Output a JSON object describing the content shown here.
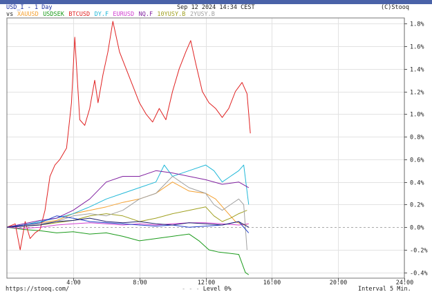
{
  "header": {
    "symbol_line": "USD_I - 1 Day",
    "datetime": "Sep 12 2024 14:34 CEST",
    "copyright": "(C)Stooq",
    "vs_label": "vs"
  },
  "footer": {
    "source": "https://stooq.com/",
    "level": "Level 0%",
    "interval": "Interval 5 Min."
  },
  "chart_data": {
    "type": "line",
    "xlabel": "",
    "ylabel": "",
    "x_unit": "hours",
    "xlim": [
      0,
      24
    ],
    "ylim": [
      -0.45,
      1.85
    ],
    "grid": true,
    "legend_position": "top-left",
    "x_ticks": [
      {
        "x": 4,
        "label": "4:00"
      },
      {
        "x": 8,
        "label": "8:00"
      },
      {
        "x": 12,
        "label": "12:00"
      },
      {
        "x": 16,
        "label": "16:00"
      },
      {
        "x": 20,
        "label": "20:00"
      },
      {
        "x": 24,
        "label": "24:00"
      }
    ],
    "y_ticks": [
      {
        "y": 1.8,
        "label": "1.8%"
      },
      {
        "y": 1.6,
        "label": "1.6%"
      },
      {
        "y": 1.4,
        "label": "1.4%"
      },
      {
        "y": 1.2,
        "label": "1.2%"
      },
      {
        "y": 1.0,
        "label": "1.0%"
      },
      {
        "y": 0.8,
        "label": "0.8%"
      },
      {
        "y": 0.6,
        "label": "0.6%"
      },
      {
        "y": 0.4,
        "label": "0.4%"
      },
      {
        "y": 0.2,
        "label": "0.2%"
      },
      {
        "y": 0.0,
        "label": "0.0%"
      },
      {
        "y": -0.2,
        "label": "-0.2%"
      },
      {
        "y": -0.4,
        "label": "-0.4%"
      }
    ],
    "series": [
      {
        "name": "XAUUSD",
        "color": "#f4a030",
        "points": [
          [
            0,
            0
          ],
          [
            1,
            0.02
          ],
          [
            2,
            0.04
          ],
          [
            3,
            0.06
          ],
          [
            4,
            0.12
          ],
          [
            5,
            0.15
          ],
          [
            6,
            0.18
          ],
          [
            7,
            0.22
          ],
          [
            8,
            0.25
          ],
          [
            9,
            0.3
          ],
          [
            10,
            0.4
          ],
          [
            11,
            0.32
          ],
          [
            12,
            0.3
          ],
          [
            12.6,
            0.25
          ],
          [
            13.2,
            0.15
          ],
          [
            13.8,
            0.05
          ],
          [
            14.3,
            0.02
          ],
          [
            14.6,
            0.03
          ]
        ]
      },
      {
        "name": "USDSEK",
        "color": "#1a9a1a",
        "points": [
          [
            0,
            0
          ],
          [
            1,
            -0.02
          ],
          [
            2,
            -0.03
          ],
          [
            3,
            -0.05
          ],
          [
            4,
            -0.04
          ],
          [
            5,
            -0.06
          ],
          [
            6,
            -0.05
          ],
          [
            7,
            -0.08
          ],
          [
            8,
            -0.12
          ],
          [
            9,
            -0.1
          ],
          [
            10,
            -0.08
          ],
          [
            11,
            -0.06
          ],
          [
            11.6,
            -0.12
          ],
          [
            12.2,
            -0.2
          ],
          [
            12.8,
            -0.22
          ],
          [
            13.4,
            -0.23
          ],
          [
            14,
            -0.24
          ],
          [
            14.4,
            -0.4
          ],
          [
            14.6,
            -0.42
          ]
        ]
      },
      {
        "name": "BTCUSD",
        "color": "#e02020",
        "points": [
          [
            0,
            0
          ],
          [
            0.5,
            0.03
          ],
          [
            0.8,
            -0.2
          ],
          [
            1.1,
            0.05
          ],
          [
            1.4,
            -0.1
          ],
          [
            1.7,
            -0.05
          ],
          [
            2,
            -0.02
          ],
          [
            2.3,
            0.15
          ],
          [
            2.6,
            0.45
          ],
          [
            2.9,
            0.55
          ],
          [
            3.2,
            0.6
          ],
          [
            3.6,
            0.7
          ],
          [
            3.9,
            1.1
          ],
          [
            4.1,
            1.68
          ],
          [
            4.4,
            0.95
          ],
          [
            4.7,
            0.9
          ],
          [
            5,
            1.05
          ],
          [
            5.3,
            1.3
          ],
          [
            5.5,
            1.1
          ],
          [
            5.8,
            1.35
          ],
          [
            6.1,
            1.55
          ],
          [
            6.4,
            1.82
          ],
          [
            6.8,
            1.55
          ],
          [
            7.2,
            1.4
          ],
          [
            7.6,
            1.25
          ],
          [
            8,
            1.1
          ],
          [
            8.4,
            1.0
          ],
          [
            8.8,
            0.93
          ],
          [
            9.2,
            1.05
          ],
          [
            9.6,
            0.95
          ],
          [
            10,
            1.2
          ],
          [
            10.4,
            1.4
          ],
          [
            10.8,
            1.55
          ],
          [
            11.1,
            1.65
          ],
          [
            11.4,
            1.45
          ],
          [
            11.8,
            1.2
          ],
          [
            12.2,
            1.1
          ],
          [
            12.6,
            1.05
          ],
          [
            13,
            0.97
          ],
          [
            13.4,
            1.05
          ],
          [
            13.8,
            1.2
          ],
          [
            14.2,
            1.28
          ],
          [
            14.5,
            1.18
          ],
          [
            14.7,
            0.83
          ]
        ]
      },
      {
        "name": "DY.F",
        "color": "#20b8d8",
        "points": [
          [
            0,
            0
          ],
          [
            1,
            0.02
          ],
          [
            2,
            0.05
          ],
          [
            3,
            0.08
          ],
          [
            4,
            0.12
          ],
          [
            5,
            0.18
          ],
          [
            6,
            0.25
          ],
          [
            7,
            0.3
          ],
          [
            8,
            0.35
          ],
          [
            9,
            0.4
          ],
          [
            9.5,
            0.55
          ],
          [
            10,
            0.45
          ],
          [
            11,
            0.5
          ],
          [
            12,
            0.55
          ],
          [
            12.5,
            0.5
          ],
          [
            13,
            0.4
          ],
          [
            13.5,
            0.45
          ],
          [
            14,
            0.5
          ],
          [
            14.3,
            0.55
          ],
          [
            14.6,
            0.2
          ]
        ]
      },
      {
        "name": "EURUSD",
        "color": "#d040d0",
        "points": [
          [
            0,
            0
          ],
          [
            1,
            -0.01
          ],
          [
            2,
            0.0
          ],
          [
            3,
            0.02
          ],
          [
            4,
            0.03
          ],
          [
            5,
            0.04
          ],
          [
            6,
            0.03
          ],
          [
            7,
            0.02
          ],
          [
            8,
            0.03
          ],
          [
            9,
            0.02
          ],
          [
            10,
            0.03
          ],
          [
            11,
            0.04
          ],
          [
            12,
            0.04
          ],
          [
            13,
            0.03
          ],
          [
            14,
            0.02
          ],
          [
            14.6,
            0.03
          ]
        ]
      },
      {
        "name": "NQ.F",
        "color": "#8020a0",
        "points": [
          [
            0,
            0
          ],
          [
            1,
            0.03
          ],
          [
            2,
            0.06
          ],
          [
            3,
            0.08
          ],
          [
            4,
            0.15
          ],
          [
            5,
            0.25
          ],
          [
            6,
            0.4
          ],
          [
            7,
            0.45
          ],
          [
            8,
            0.45
          ],
          [
            9,
            0.5
          ],
          [
            10,
            0.48
          ],
          [
            11,
            0.45
          ],
          [
            12,
            0.42
          ],
          [
            13,
            0.38
          ],
          [
            14,
            0.4
          ],
          [
            14.6,
            0.35
          ]
        ]
      },
      {
        "name": "10YUSY.B",
        "color": "#a0a020",
        "points": [
          [
            0,
            0
          ],
          [
            1,
            0.01
          ],
          [
            2,
            0.02
          ],
          [
            3,
            0.04
          ],
          [
            4,
            0.06
          ],
          [
            5,
            0.1
          ],
          [
            6,
            0.12
          ],
          [
            7,
            0.1
          ],
          [
            8,
            0.05
          ],
          [
            9,
            0.08
          ],
          [
            10,
            0.12
          ],
          [
            11,
            0.15
          ],
          [
            12,
            0.18
          ],
          [
            12.5,
            0.1
          ],
          [
            13,
            0.05
          ],
          [
            13.5,
            0.08
          ],
          [
            14,
            0.12
          ],
          [
            14.5,
            0.15
          ]
        ]
      },
      {
        "name": "2YUSY.B",
        "color": "#a0a0a0",
        "points": [
          [
            0,
            0
          ],
          [
            1,
            0.01
          ],
          [
            2,
            0.03
          ],
          [
            3,
            0.05
          ],
          [
            4,
            0.1
          ],
          [
            5,
            0.12
          ],
          [
            6,
            0.1
          ],
          [
            7,
            0.15
          ],
          [
            8,
            0.25
          ],
          [
            9,
            0.3
          ],
          [
            10,
            0.45
          ],
          [
            11,
            0.35
          ],
          [
            12,
            0.3
          ],
          [
            12.5,
            0.2
          ],
          [
            13,
            0.15
          ],
          [
            13.5,
            0.2
          ],
          [
            14,
            0.25
          ],
          [
            14.3,
            0.2
          ],
          [
            14.5,
            -0.2
          ]
        ]
      },
      {
        "name": "",
        "color": "#1e3ec8",
        "points": [
          [
            0,
            0
          ],
          [
            1,
            0.02
          ],
          [
            2,
            0.04
          ],
          [
            3,
            0.1
          ],
          [
            4,
            0.08
          ],
          [
            5,
            0.05
          ],
          [
            6,
            0.04
          ],
          [
            7,
            0.03
          ],
          [
            8,
            0.02
          ],
          [
            9,
            0.01
          ],
          [
            10,
            0.02
          ],
          [
            11,
            0.0
          ],
          [
            12,
            0.01
          ],
          [
            13,
            0.02
          ],
          [
            14,
            0.05
          ],
          [
            14.6,
            -0.05
          ]
        ]
      },
      {
        "name": "",
        "color": "#202070",
        "points": [
          [
            0,
            0
          ],
          [
            1,
            0.01
          ],
          [
            2,
            0.02
          ],
          [
            3,
            0.05
          ],
          [
            4,
            0.06
          ],
          [
            5,
            0.08
          ],
          [
            6,
            0.05
          ],
          [
            7,
            0.04
          ],
          [
            8,
            0.05
          ],
          [
            9,
            0.03
          ],
          [
            10,
            0.02
          ],
          [
            11,
            0.04
          ],
          [
            12,
            0.03
          ],
          [
            13,
            0.02
          ],
          [
            14,
            0.05
          ],
          [
            14.6,
            0.0
          ]
        ]
      }
    ]
  }
}
